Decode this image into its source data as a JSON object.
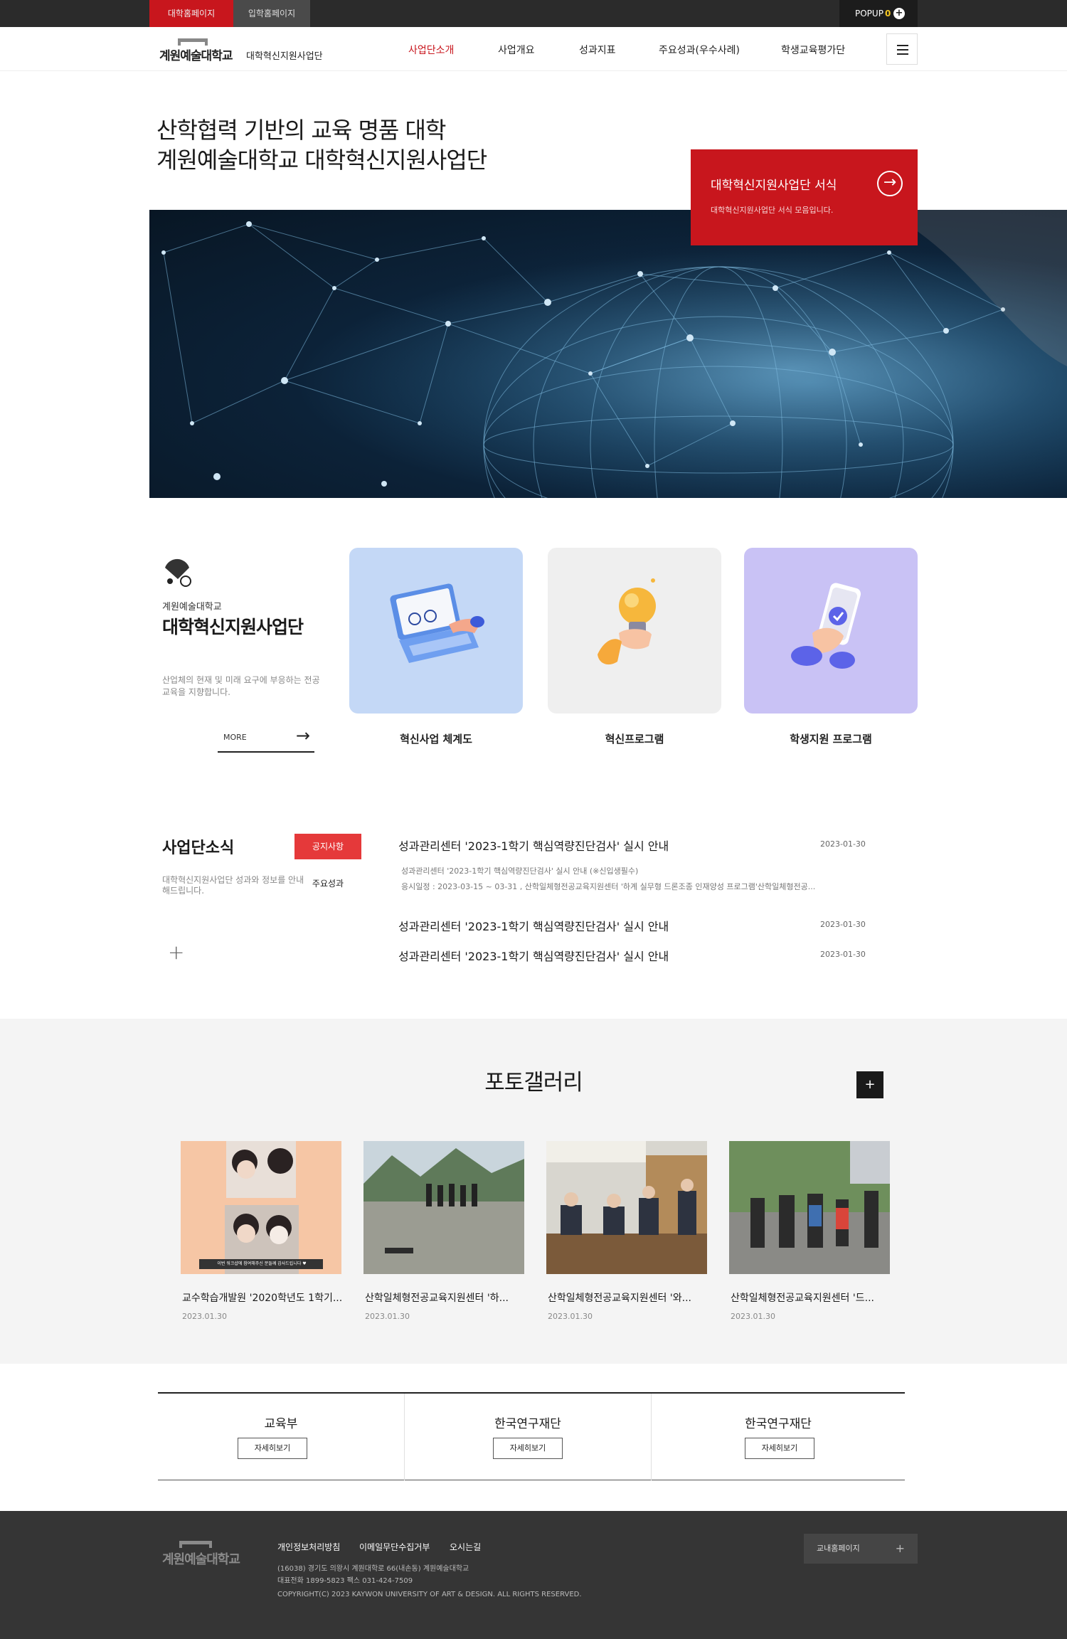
{
  "utility": {
    "tab_univ": "대학홈페이지",
    "tab_admission": "입학홈페이지",
    "popup_label": "POPUP",
    "popup_count": "0"
  },
  "header": {
    "logo_name": "계원예술대학교",
    "logo_sub": "대학혁신지원사업단",
    "nav": [
      "사업단소개",
      "사업개요",
      "성과지표",
      "주요성과(우수사례)",
      "학생교육평가단"
    ]
  },
  "hero": {
    "title_line1": "산학협력 기반의 교육 명품 대학",
    "title_line2": "계원예술대학교 대학혁신지원사업단",
    "card_title": "대학혁신지원사업단 서식",
    "card_desc": "대학혁신지원사업단 서식 모음입니다.",
    "accent": "#c8161d"
  },
  "intro": {
    "small": "계원예술대학교",
    "title": "대학혁신지원사업단",
    "desc": "산업체의 현재 및 미래 요구에 부응하는 전공교육을 지향합니다.",
    "more": "MORE",
    "cards": [
      {
        "label": "혁신사업 체계도",
        "bg": "#c4d8f6"
      },
      {
        "label": "혁신프로그램",
        "bg": "#efefef"
      },
      {
        "label": "학생지원 프로그램",
        "bg": "#c9c2f5"
      }
    ]
  },
  "news": {
    "title": "사업단소식",
    "desc": "대학혁신지원사업단 성과와 정보를 안내해드립니다.",
    "tab_notice": "공지사항",
    "tab_result": "주요성과",
    "items": [
      {
        "title": "성과관리센터 '2023-1학기 핵심역량진단검사' 실시 안내",
        "date": "2023-01-30",
        "body1": "성과관리센터 '2023-1학기 핵심역량진단검사' 실시 안내 (※신입생필수)",
        "body2": "응시일정 : 2023-03-15 ~ 03-31 , 산학일체형전공교육지원센터 '하계 실무형 드론조종 인재양성 프로그램'산학일체형전공..."
      },
      {
        "title": "성과관리센터 '2023-1학기 핵심역량진단검사' 실시 안내",
        "date": "2023-01-30"
      },
      {
        "title": "성과관리센터 '2023-1학기 핵심역량진단검사' 실시 안내",
        "date": "2023-01-30"
      }
    ]
  },
  "gallery": {
    "title": "포토갤러리",
    "items": [
      {
        "caption": "교수학습개발원 '2020학년도 1학기...",
        "date": "2023.01.30",
        "overlay": "이번 워크샵에 참여해주신 분들께 감사드립니다 ♥"
      },
      {
        "caption": "산학일체형전공교육지원센터 '하...",
        "date": "2023.01.30"
      },
      {
        "caption": "산학일체형전공교육지원센터 '와...",
        "date": "2023.01.30"
      },
      {
        "caption": "산학일체형전공교육지원센터 '드...",
        "date": "2023.01.30"
      }
    ]
  },
  "links": [
    {
      "title": "교육부",
      "btn": "자세히보기"
    },
    {
      "title": "한국연구재단",
      "btn": "자세히보기"
    },
    {
      "title": "한국연구재단",
      "btn": "자세히보기"
    }
  ],
  "footer": {
    "logo": "계원예술대학교",
    "links": [
      "개인정보처리방침",
      "이메일무단수집거부",
      "오시는길"
    ],
    "address": "(16038) 경기도 의왕시 계원대학로 66(내손동) 계원예술대학교",
    "phone": "대표전화 1899-5823 팩스 031-424-7509",
    "copyright": "COPYRIGHT(C) 2023 KAYWON UNIVERSITY OF ART & DESIGN. ALL RIGHTS RESERVED.",
    "select_label": "교내홈페이지"
  }
}
